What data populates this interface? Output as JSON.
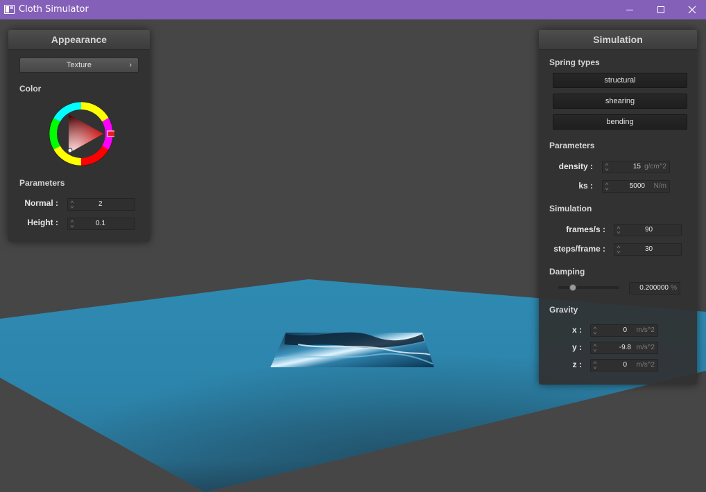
{
  "window": {
    "title": "Cloth Simulator",
    "icon": "app-window-icon",
    "controls": [
      "minimize-icon",
      "maximize-icon",
      "close-icon"
    ]
  },
  "colors": {
    "titlebar": "#8560b9",
    "background": "#464646",
    "floor": "#2e86ac",
    "panel": "#303030",
    "selected_color": "#e02020"
  },
  "appearance": {
    "title": "Appearance",
    "texture_button": "Texture",
    "color_label": "Color",
    "parameters_label": "Parameters",
    "normal": {
      "label": "Normal :",
      "value": "2"
    },
    "height": {
      "label": "Height :",
      "value": "0.1"
    }
  },
  "simulation": {
    "title": "Simulation",
    "spring_types_label": "Spring types",
    "spring_buttons": [
      "structural",
      "shearing",
      "bending"
    ],
    "parameters_label": "Parameters",
    "density": {
      "label": "density :",
      "value": "15",
      "unit": "g/cm^2"
    },
    "ks": {
      "label": "ks :",
      "value": "5000",
      "unit": "N/m"
    },
    "simulation_label": "Simulation",
    "frames": {
      "label": "frames/s :",
      "value": "90"
    },
    "steps": {
      "label": "steps/frame :",
      "value": "30"
    },
    "damping_label": "Damping",
    "damping": {
      "value": "0.200000",
      "unit": "%",
      "slider_fraction": 0.2
    },
    "gravity_label": "Gravity",
    "gravity_x": {
      "label": "x :",
      "value": "0",
      "unit": "m/s^2"
    },
    "gravity_y": {
      "label": "y :",
      "value": "-9.8",
      "unit": "m/s^2"
    },
    "gravity_z": {
      "label": "z :",
      "value": "0",
      "unit": "m/s^2"
    }
  }
}
